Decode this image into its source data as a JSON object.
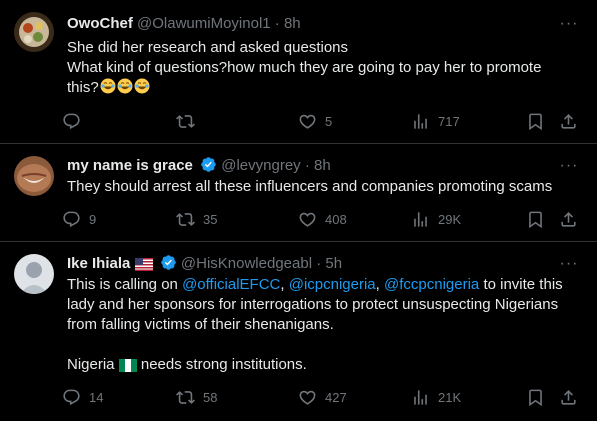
{
  "tweets": [
    {
      "name": "OwoChef",
      "handle": "@OlawumiMoyinol1",
      "dot": "·",
      "time": "8h",
      "lines": [
        "She did her research and asked questions",
        "What kind of questions?how much they are going to pay her to promote",
        "this?"
      ],
      "emojis": [
        "joy-emoji",
        "joy-emoji",
        "joy-emoji"
      ],
      "replies": "",
      "retweets": "",
      "likes": "5",
      "views": "717"
    },
    {
      "name": "my name is grace",
      "handle": "@levyngrey",
      "dot": "·",
      "time": "8h",
      "lines": [
        "They should arrest all these influencers and companies promoting scams"
      ],
      "replies": "9",
      "retweets": "35",
      "likes": "408",
      "views": "29K"
    },
    {
      "name": "Ike Ihiala",
      "handle": "@HisKnowledgeabl",
      "dot": "·",
      "time": "5h",
      "line1_prefix": "This is calling on ",
      "mention1": "@officialEFCC",
      "sep1": ", ",
      "mention2": "@icpcnigeria",
      "sep2": ", ",
      "mention3": "@fccpcnigeria",
      "line1_suffix": " to invite this",
      "line2": "lady and her sponsors for interrogations to protect unsuspecting Nigerians",
      "line3": "from falling victims of their shenanigans.",
      "line4_prefix": "Nigeria",
      "line4_suffix": " needs strong institutions.",
      "replies": "14",
      "retweets": "58",
      "likes": "427",
      "views": "21K"
    }
  ],
  "more_label": "···",
  "colors": {
    "background": "#000000",
    "text": "#e7e9ea",
    "secondary": "#71767b",
    "accent": "#1d9bf0",
    "divider": "#2f3336"
  }
}
